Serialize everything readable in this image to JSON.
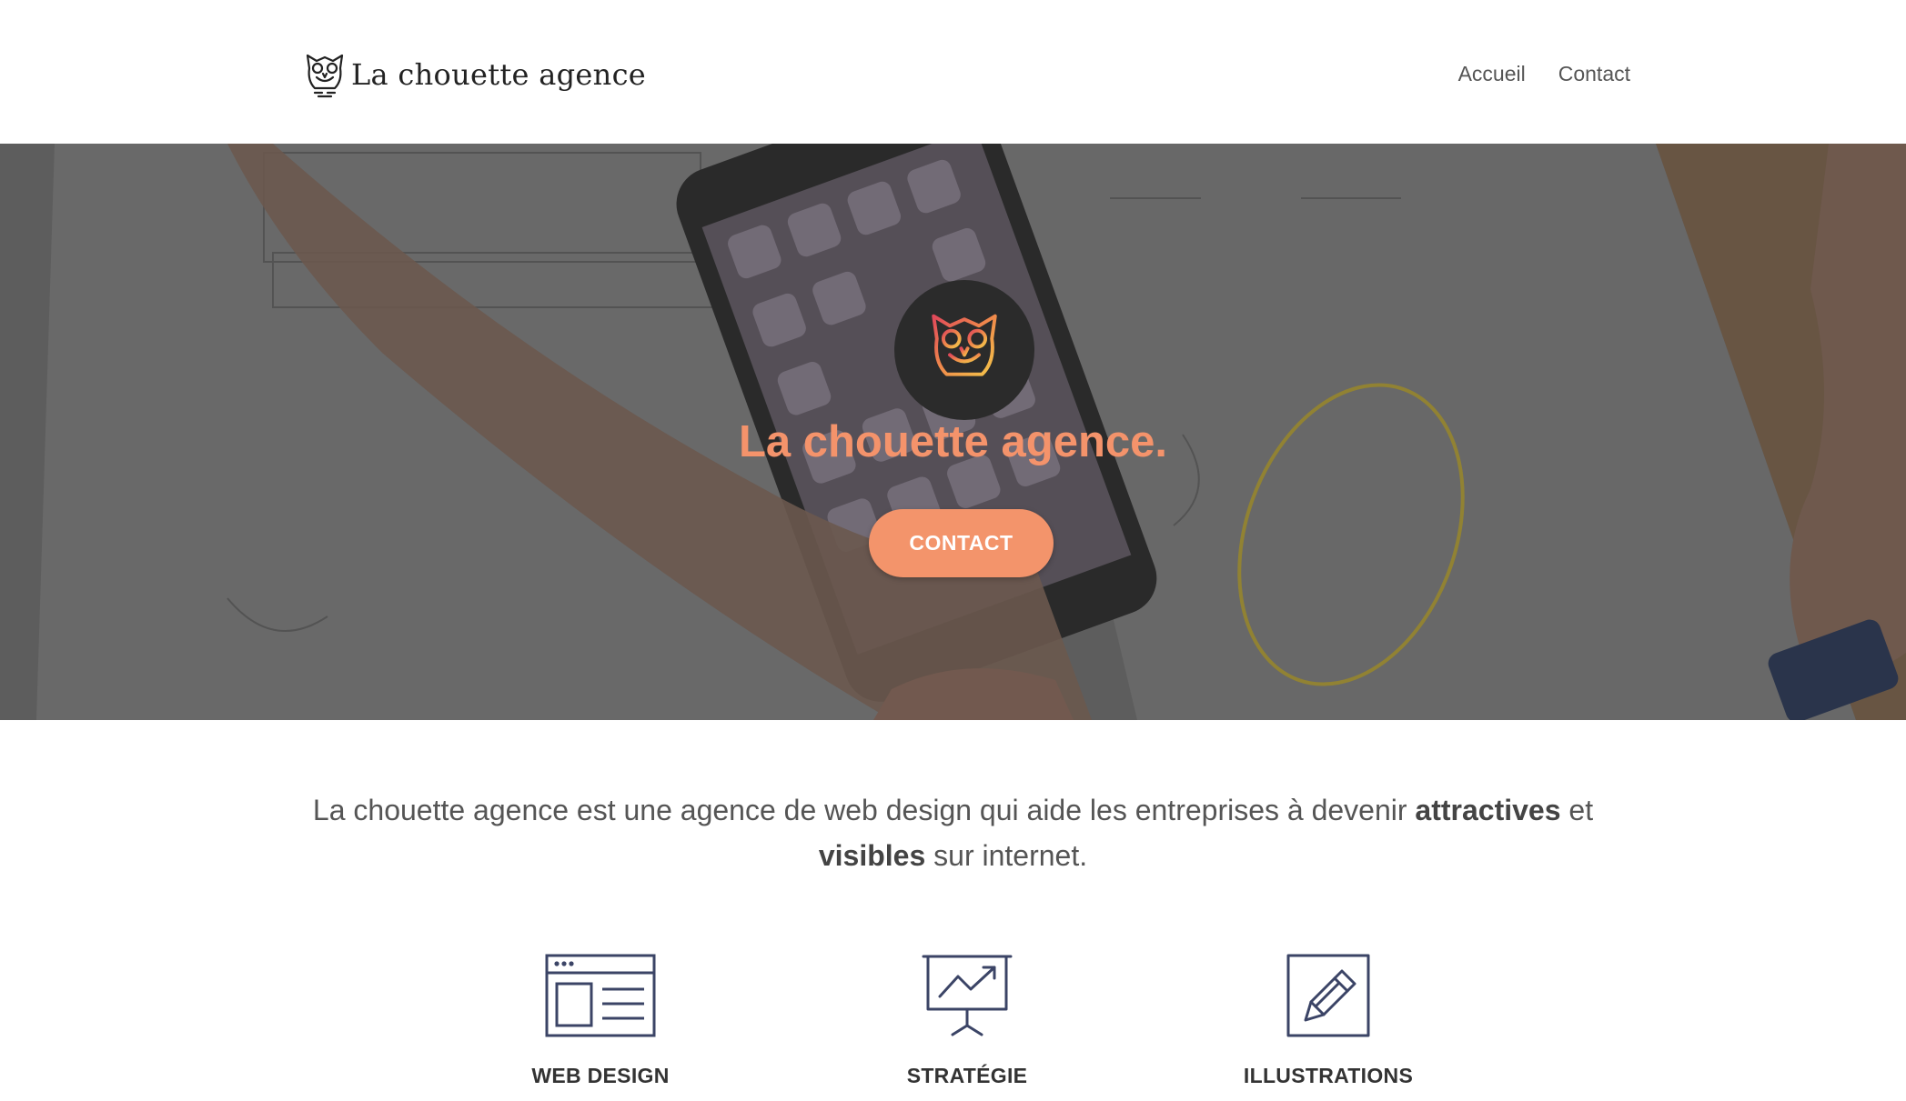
{
  "header": {
    "logo_text": "La chouette agence",
    "nav": [
      {
        "label": "Accueil"
      },
      {
        "label": "Contact"
      }
    ]
  },
  "hero": {
    "title": "La chouette agence.",
    "button_label": "CONTACT"
  },
  "intro": {
    "part1": "La chouette agence est une agence de web design qui aide les entreprises à devenir ",
    "bold1": "attractives",
    "part2": " et ",
    "bold2": "visibles",
    "part3": " sur internet."
  },
  "services": [
    {
      "label": "WEB DESIGN",
      "icon": "browser-window-icon"
    },
    {
      "label": "STRATÉGIE",
      "icon": "presentation-chart-icon"
    },
    {
      "label": "ILLUSTRATIONS",
      "icon": "pencil-icon"
    }
  ],
  "colors": {
    "accent": "#f3946b",
    "icon_stroke": "#3b4466",
    "text": "#555555"
  }
}
